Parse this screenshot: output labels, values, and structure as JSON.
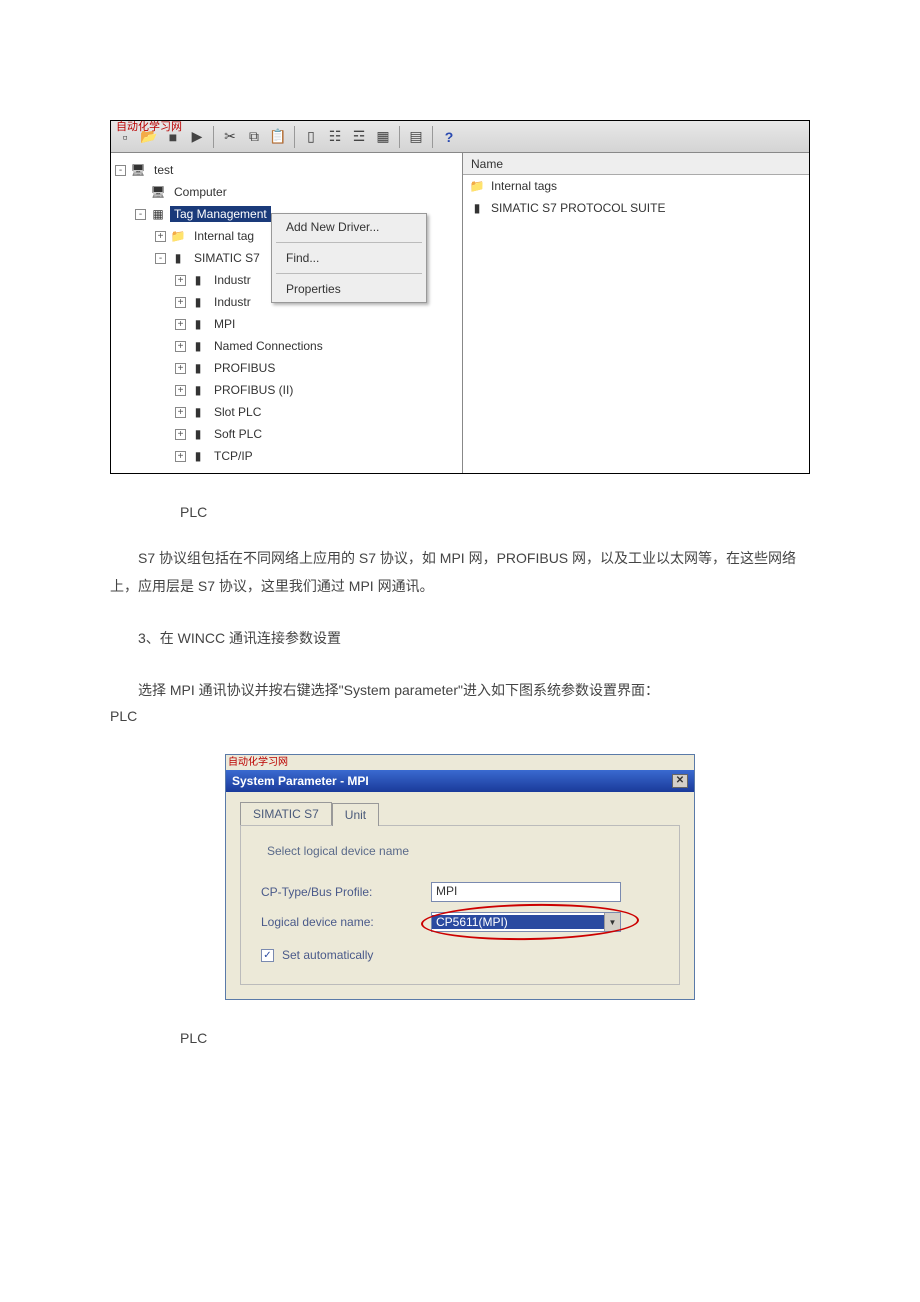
{
  "fig1": {
    "watermark": "自动化学习网",
    "tree": {
      "root": "test",
      "computer": "Computer",
      "tag_mgmt": "Tag Management",
      "internal_tags": "Internal tag",
      "simatic_node": "SIMATIC S7",
      "industr1": "Industr",
      "industr2": "Industr",
      "mpi": "MPI",
      "named_conn": "Named Connections",
      "profibus": "PROFIBUS",
      "profibus2": "PROFIBUS (II)",
      "slot_plc": "Slot PLC",
      "soft_plc": "Soft PLC",
      "tcpip": "TCP/IP"
    },
    "ctx": {
      "add_driver": "Add New Driver...",
      "find": "Find...",
      "properties": "Properties"
    },
    "list": {
      "header": "Name",
      "row1": "Internal tags",
      "row2": "SIMATIC S7 PROTOCOL SUITE"
    }
  },
  "text": {
    "plc1": "PLC",
    "p1": "S7 协议组包括在不同网络上应用的 S7 协议，如 MPI 网，PROFIBUS 网，以及工业以太网等，在这些网络上，应用层是 S7 协议，这里我们通过 MPI 网通讯。",
    "p2": "3、在 WINCC 通讯连接参数设置",
    "p3": "选择 MPI 通讯协议并按右键选择\"System parameter\"进入如下图系统参数设置界面：",
    "plc2": "PLC",
    "plc3": "PLC"
  },
  "fig2": {
    "watermark": "自动化学习网",
    "title": "System Parameter - MPI",
    "tab1": "SIMATIC S7",
    "tab2": "Unit",
    "group": "Select logical device name",
    "row1_lbl": "CP-Type/Bus Profile:",
    "row1_val": "MPI",
    "row2_lbl": "Logical device name:",
    "row2_val": "CP5611(MPI)",
    "chk": "Set automatically"
  }
}
